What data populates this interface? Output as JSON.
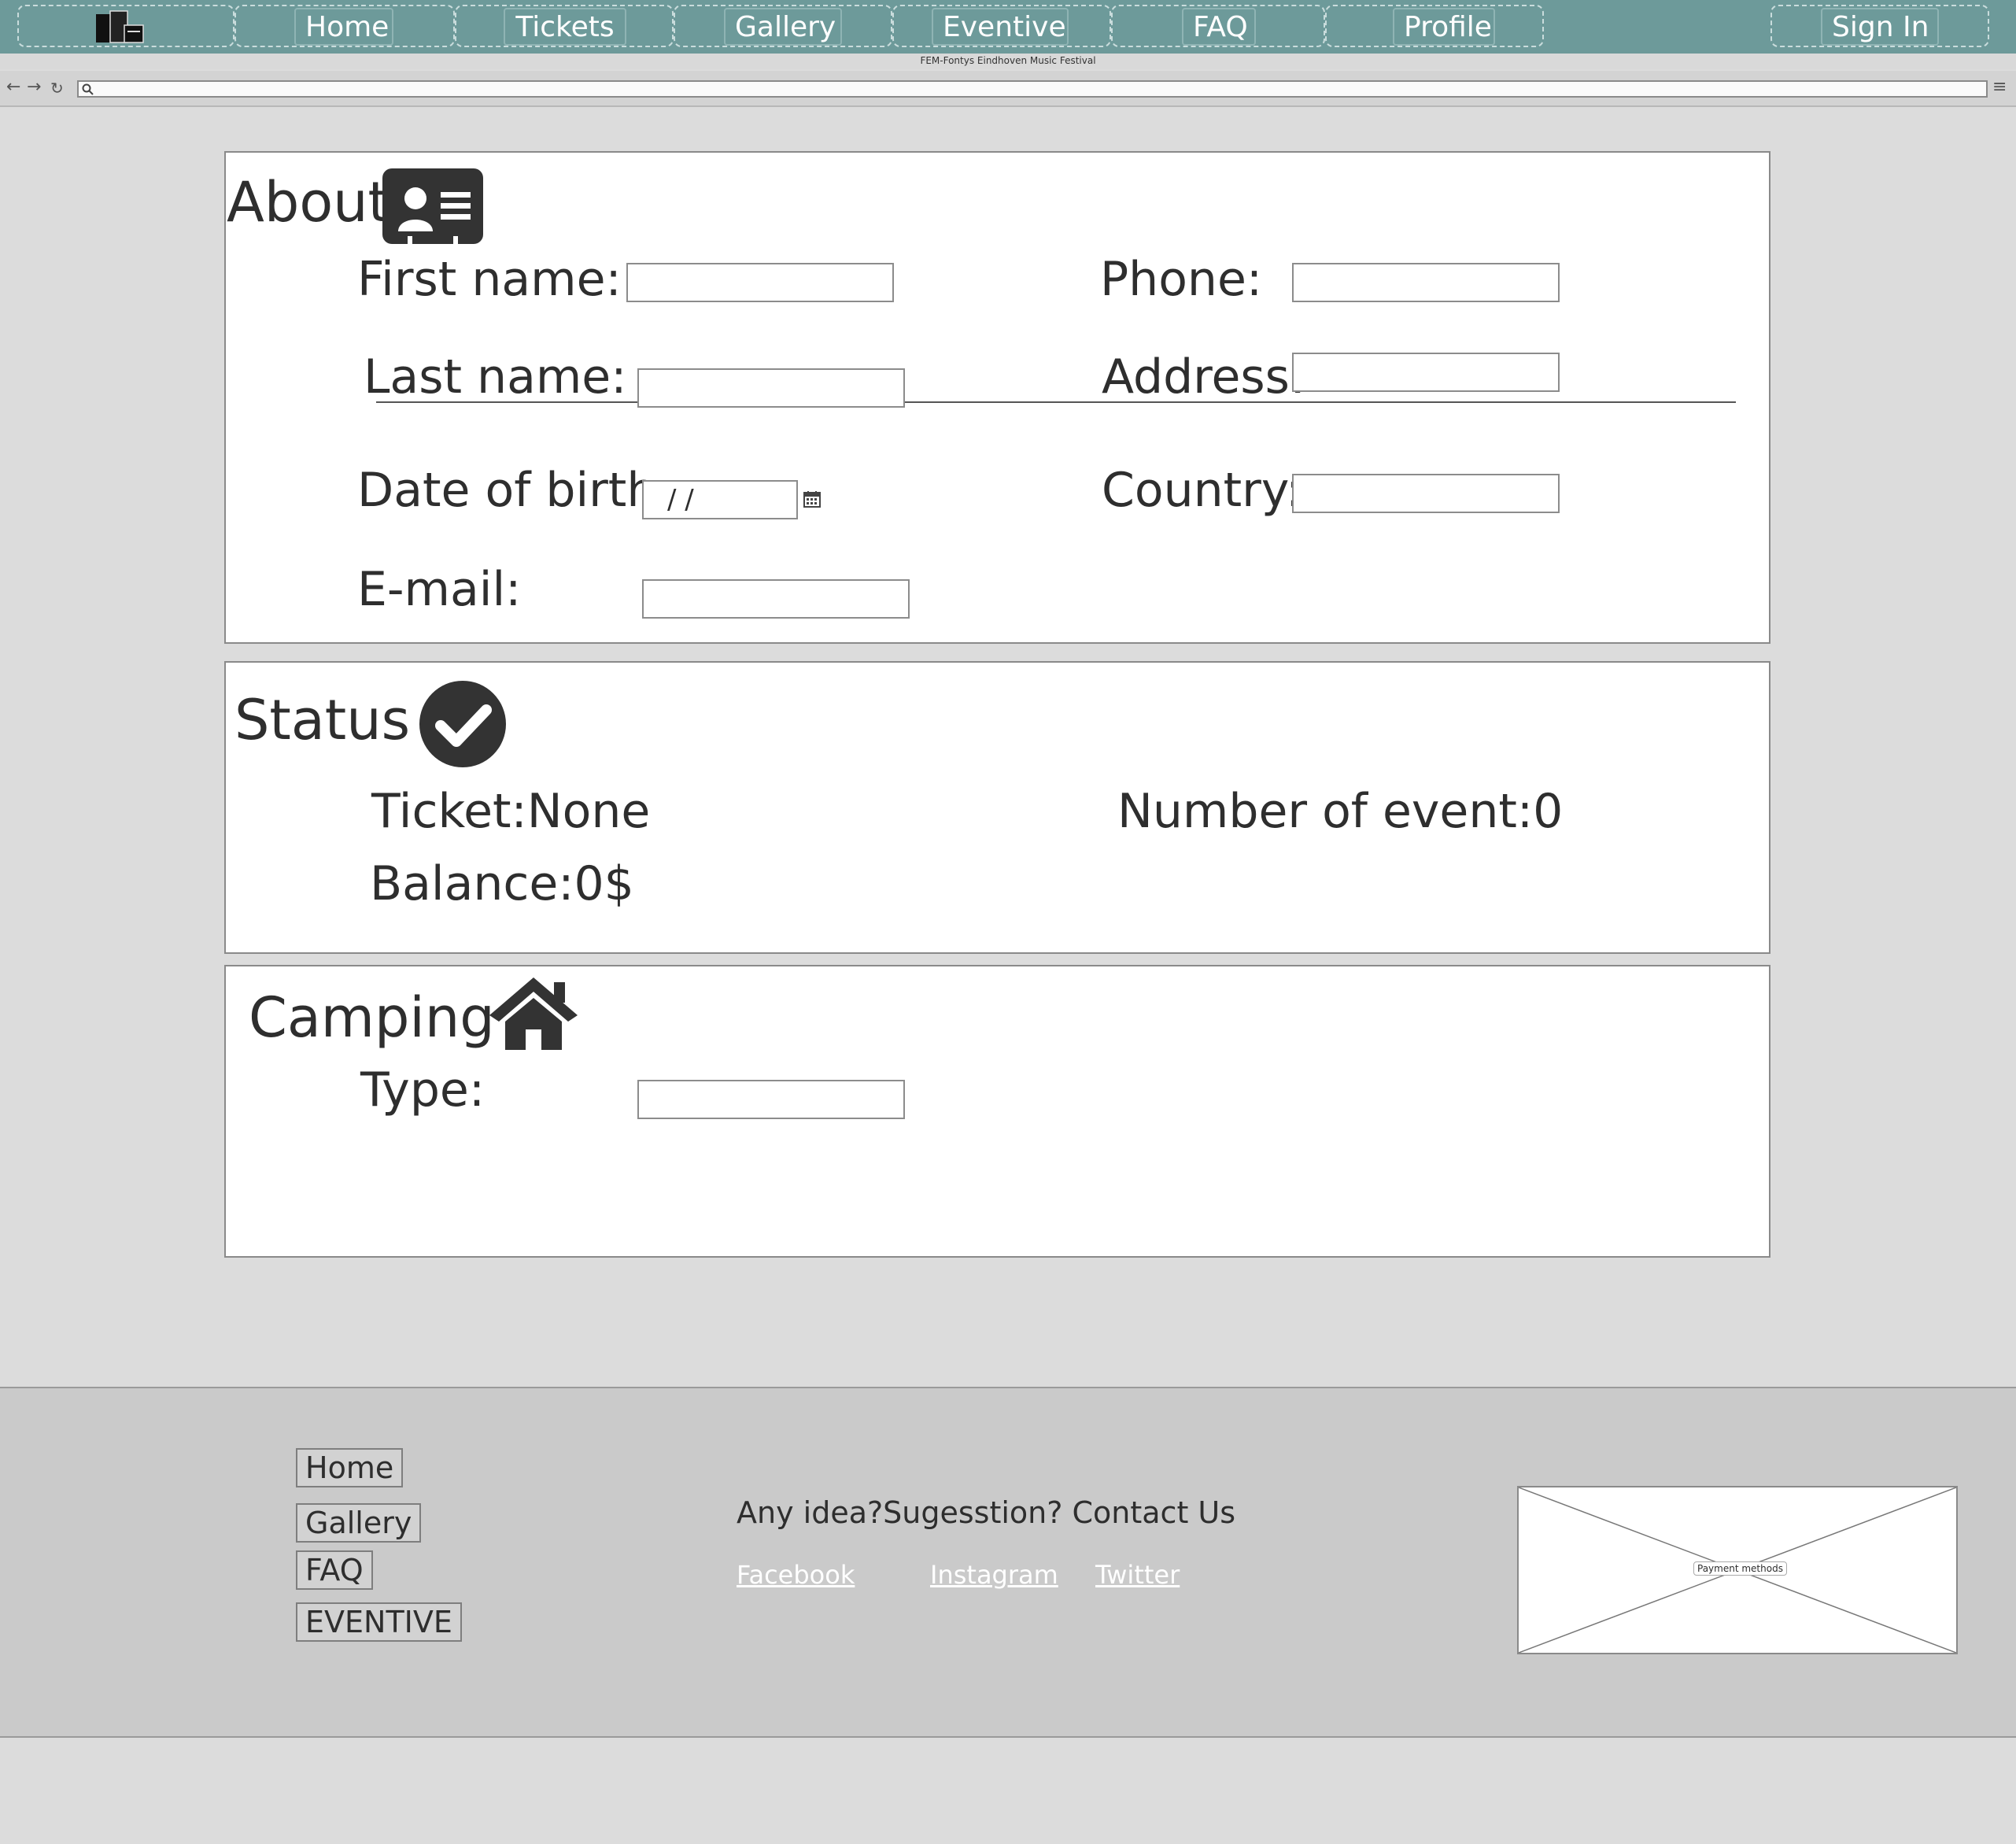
{
  "nav": {
    "items": [
      "Home",
      "Tickets",
      "Gallery",
      "Eventive",
      "FAQ",
      "Profile"
    ],
    "sign_in": "Sign In",
    "subtitle": "FEM-Fontys Eindhoven Music Festival"
  },
  "about": {
    "title": "About",
    "first_name_label": "First name:",
    "last_name_label": "Last name:",
    "dob_label": "Date of birth:",
    "dob_value": "/  /",
    "email_label": "E-mail:",
    "phone_label": "Phone:",
    "address_label": "Address:",
    "country_label": "Country:"
  },
  "status": {
    "title": "Status",
    "ticket": "Ticket:None",
    "balance": "Balance:0$",
    "events": "Number of event:0"
  },
  "camping": {
    "title": "Camping",
    "type_label": "Type:"
  },
  "footer": {
    "links": [
      "Home",
      "Gallery",
      "FAQ",
      "EVENTIVE"
    ],
    "contact": "Any idea?Sugesstion? Contact Us",
    "social": [
      "Facebook",
      "Instagram",
      "Twitter"
    ],
    "payment_label": "Payment methods"
  }
}
